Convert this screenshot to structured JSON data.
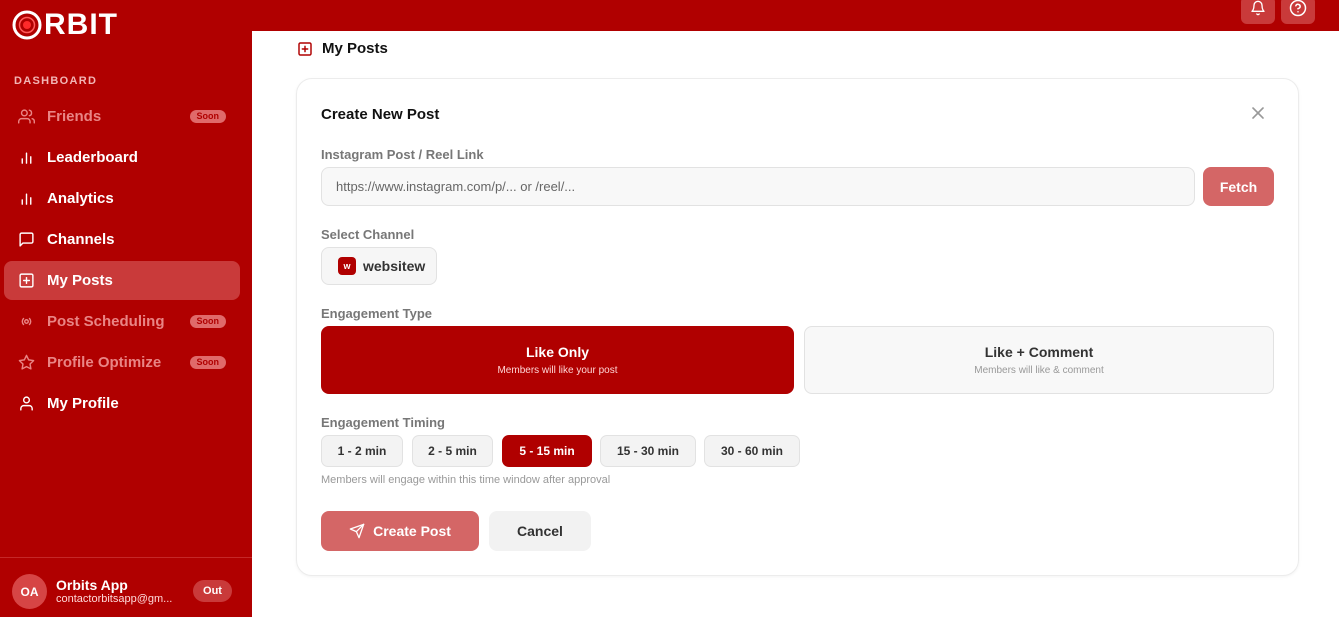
{
  "app": {
    "logo_text": "RBIT"
  },
  "header": {
    "bell_icon": "bell-icon",
    "help_icon": "help-circle-icon"
  },
  "sidebar": {
    "section_label": "DASHBOARD",
    "items": [
      {
        "label": "Friends",
        "icon": "users-icon",
        "badge": "Soon"
      },
      {
        "label": "Leaderboard",
        "icon": "bar-chart-icon"
      },
      {
        "label": "Analytics",
        "icon": "bar-chart-icon"
      },
      {
        "label": "Channels",
        "icon": "message-square-icon"
      },
      {
        "label": "My Posts",
        "icon": "plus-square-icon"
      },
      {
        "label": "Post Scheduling",
        "icon": "radio-icon",
        "badge": "Soon"
      },
      {
        "label": "Profile Optimize",
        "icon": "star-icon",
        "badge": "Soon"
      },
      {
        "label": "My Profile",
        "icon": "user-icon"
      }
    ],
    "user": {
      "initials": "OA",
      "name": "Orbits App",
      "email": "contactorbitsapp@gm...",
      "logout_label": "Out"
    }
  },
  "page": {
    "title": "My Posts"
  },
  "form": {
    "title": "Create New Post",
    "link_label": "Instagram Post / Reel Link",
    "link_placeholder": "https://www.instagram.com/p/... or /reel/...",
    "fetch_label": "Fetch",
    "channel_label": "Select Channel",
    "channel": {
      "badge": "w",
      "name": "websitew"
    },
    "engagement_label": "Engagement Type",
    "engagement_options": [
      {
        "title": "Like Only",
        "subtitle": "Members will like your post",
        "selected": true
      },
      {
        "title": "Like + Comment",
        "subtitle": "Members will like & comment",
        "selected": false
      }
    ],
    "timing_label": "Engagement Timing",
    "timing_options": [
      "1 - 2 min",
      "2 - 5 min",
      "5 - 15 min",
      "15 - 30 min",
      "30 - 60 min"
    ],
    "timing_selected": "5 - 15 min",
    "timing_hint": "Members will engage within this time window after approval",
    "create_label": "Create Post",
    "cancel_label": "Cancel"
  },
  "colors": {
    "brand": "#b00000",
    "brand_light": "#d46666",
    "sidebar_active": "#c93a3a"
  }
}
